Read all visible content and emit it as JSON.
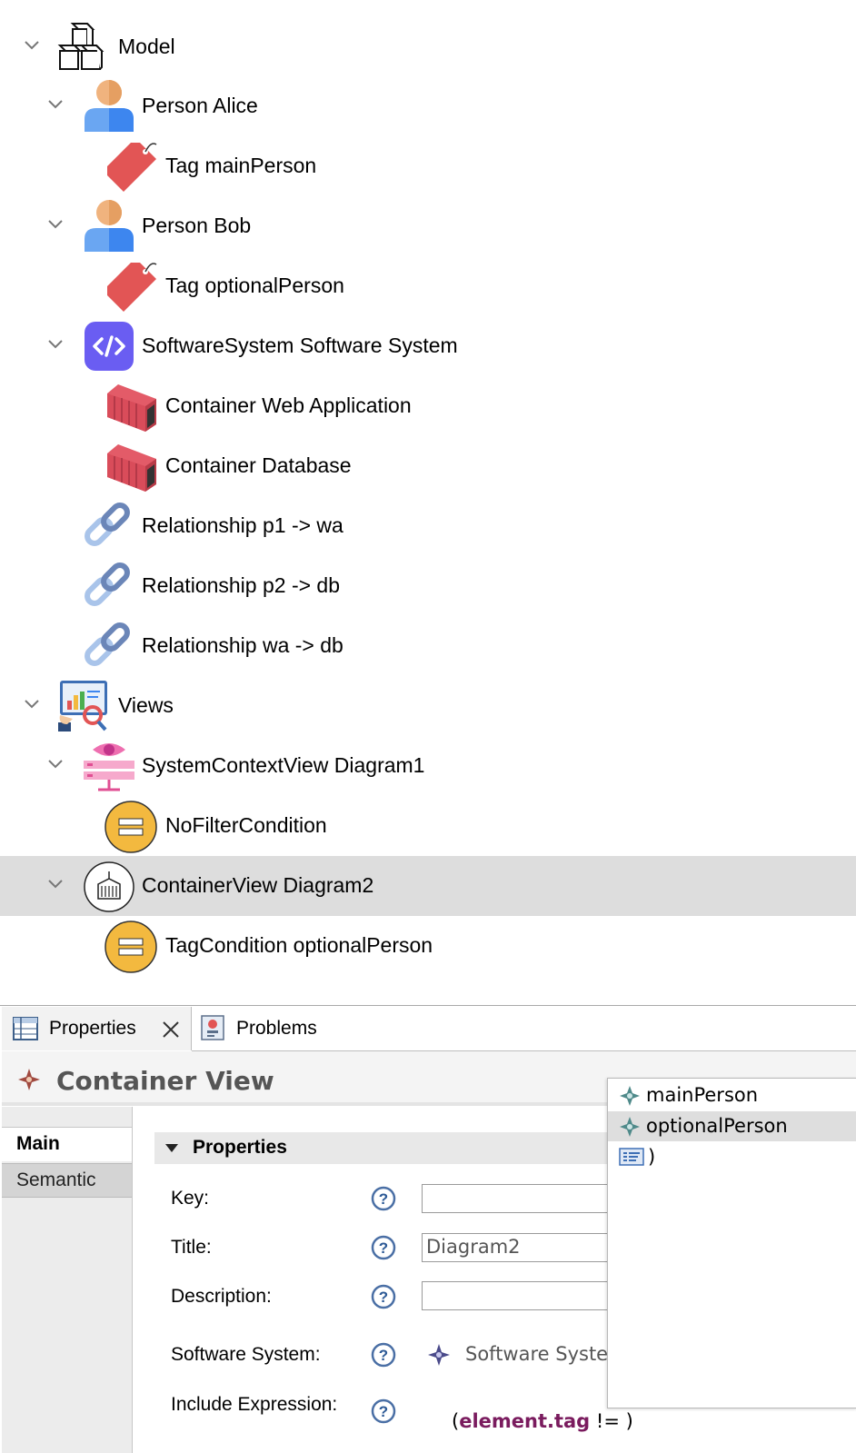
{
  "tree": [
    {
      "label": "Model",
      "icon": "cubes-icon",
      "expanded": true
    },
    {
      "label": "Person Alice",
      "icon": "person-icon",
      "expanded": true
    },
    {
      "label": "Tag mainPerson",
      "icon": "tag-icon"
    },
    {
      "label": "Person Bob",
      "icon": "person-icon",
      "expanded": true
    },
    {
      "label": "Tag optionalPerson",
      "icon": "tag-icon"
    },
    {
      "label": "SoftwareSystem Software System",
      "icon": "code-icon",
      "expanded": true
    },
    {
      "label": "Container Web Application",
      "icon": "shipping-container-icon"
    },
    {
      "label": "Container Database",
      "icon": "shipping-container-icon"
    },
    {
      "label": "Relationship p1 -> wa",
      "icon": "link-icon"
    },
    {
      "label": "Relationship p2 -> db",
      "icon": "link-icon"
    },
    {
      "label": "Relationship wa -> db",
      "icon": "link-icon"
    },
    {
      "label": "Views",
      "icon": "views-chart-icon",
      "expanded": true
    },
    {
      "label": "SystemContextView Diagram1",
      "icon": "system-context-icon",
      "expanded": true
    },
    {
      "label": "NoFilterCondition",
      "icon": "condition-icon"
    },
    {
      "label": "ContainerView Diagram2",
      "icon": "container-view-icon",
      "expanded": true,
      "selected": true
    },
    {
      "label": "TagCondition optionalPerson",
      "icon": "condition-icon"
    }
  ],
  "tabs": {
    "properties": "Properties",
    "problems": "Problems"
  },
  "page_title": "Container View",
  "nav": {
    "main": "Main",
    "semantic": "Semantic"
  },
  "section_title": "Properties",
  "fields": {
    "key_label": "Key:",
    "key_value": "",
    "title_label": "Title:",
    "title_value": "Diagram2",
    "description_label": "Description:",
    "description_value": "",
    "software_system_label": "Software System:",
    "software_system_value": "Software Syste",
    "include_expression_label": "Include Expression:",
    "expr_open": "(",
    "expr_keyword": "element.tag",
    "expr_rest": " != )"
  },
  "popup": [
    {
      "label": "mainPerson",
      "icon": "tag-value-icon"
    },
    {
      "label": "optionalPerson",
      "icon": "tag-value-icon",
      "selected": true
    },
    {
      "label": ")",
      "icon": "keyword-icon"
    }
  ],
  "colors": {
    "selection": "#dddddd",
    "keyword": "#7a1b5e",
    "condition": "#f3b93f",
    "tag": "#e25555"
  }
}
